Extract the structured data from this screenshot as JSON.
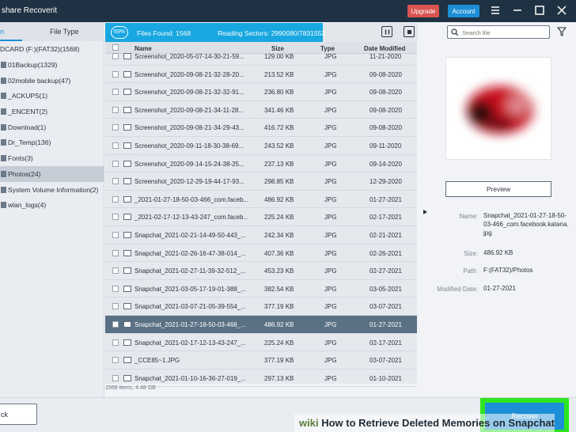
{
  "titlebar": {
    "app_title": "share Recoverit",
    "upgrade_label": "Upgrade",
    "account_label": "Account"
  },
  "sidebar": {
    "tab_active_label": "n",
    "tab_filetype_label": "File Type",
    "drive_label": "DCARD (F:)(FAT32)(1568)",
    "folders": [
      {
        "label": "01Backup(1329)",
        "selected": false
      },
      {
        "label": "02mobile backup(47)",
        "selected": false
      },
      {
        "label": "_ACKUPS(1)",
        "selected": false
      },
      {
        "label": "_ENCENT(2)",
        "selected": false
      },
      {
        "label": "Download(1)",
        "selected": false
      },
      {
        "label": "Dr_Temp(136)",
        "selected": false
      },
      {
        "label": "Fonts(3)",
        "selected": false
      },
      {
        "label": "Photos(24)",
        "selected": true
      },
      {
        "label": "System Volume Information(2)",
        "selected": false
      },
      {
        "label": "wlan_logs(4)",
        "selected": false
      }
    ]
  },
  "scan": {
    "percent": "69%",
    "files_found": "Files Found:  1568",
    "reading_sectors": "Reading Sectors:  2990080/7831552"
  },
  "table": {
    "headers": {
      "name": "Name",
      "size": "Size",
      "type": "Type",
      "date": "Date Modified"
    },
    "rows": [
      {
        "name": "Screenshot_2020-05-07-14-30-21-59...",
        "size": "129.00 KB",
        "type": "JPG",
        "date": "11-21-2020",
        "selected": false
      },
      {
        "name": "Screenshot_2020-09-08-21-32-28-20...",
        "size": "213.52 KB",
        "type": "JPG",
        "date": "09-08-2020",
        "selected": false
      },
      {
        "name": "Screenshot_2020-09-08-21-32-32-91...",
        "size": "236.80 KB",
        "type": "JPG",
        "date": "09-08-2020",
        "selected": false
      },
      {
        "name": "Screenshot_2020-09-08-21-34-11-28...",
        "size": "341.46 KB",
        "type": "JPG",
        "date": "09-08-2020",
        "selected": false
      },
      {
        "name": "Screenshot_2020-09-08-21-34-29-43...",
        "size": "416.72 KB",
        "type": "JPG",
        "date": "09-08-2020",
        "selected": false
      },
      {
        "name": "Screenshot_2020-09-11-18-30-38-69...",
        "size": "243.52 KB",
        "type": "JPG",
        "date": "09-11-2020",
        "selected": false
      },
      {
        "name": "Screenshot_2020-09-14-15-24-38-25...",
        "size": "237.13 KB",
        "type": "JPG",
        "date": "09-14-2020",
        "selected": false
      },
      {
        "name": "Screenshot_2020-12-29-19-44-17-93...",
        "size": "298.85 KB",
        "type": "JPG",
        "date": "12-29-2020",
        "selected": false
      },
      {
        "name": "_2021-01-27-18-50-03-466_com.faceb...",
        "size": "486.92 KB",
        "type": "JPG",
        "date": "01-27-2021",
        "selected": false
      },
      {
        "name": "_2021-02-17-12-13-43-247_com.faceb...",
        "size": "225.24 KB",
        "type": "JPG",
        "date": "02-17-2021",
        "selected": false
      },
      {
        "name": "Snapchat_2021-02-21-14-49-50-443_...",
        "size": "242.34 KB",
        "type": "JPG",
        "date": "02-21-2021",
        "selected": false
      },
      {
        "name": "Snapchat_2021-02-26-16-47-38-014_...",
        "size": "407.36 KB",
        "type": "JPG",
        "date": "02-26-2021",
        "selected": false
      },
      {
        "name": "Snapchat_2021-02-27-11-39-32-512_...",
        "size": "453.23 KB",
        "type": "JPG",
        "date": "02-27-2021",
        "selected": false
      },
      {
        "name": "Snapchat_2021-03-05-17-19-01-388_...",
        "size": "382.54 KB",
        "type": "JPG",
        "date": "03-05-2021",
        "selected": false
      },
      {
        "name": "Snapchat_2021-03-07-21-05-39-554_...",
        "size": "377.19 KB",
        "type": "JPG",
        "date": "03-07-2021",
        "selected": false
      },
      {
        "name": "Snapchat_2021-01-27-18-50-03-466_...",
        "size": "486.92 KB",
        "type": "JPG",
        "date": "01-27-2021",
        "selected": true
      },
      {
        "name": "Snapchat_2021-02-17-12-13-43-247_...",
        "size": "225.24 KB",
        "type": "JPG",
        "date": "02-17-2021",
        "selected": false
      },
      {
        "name": "_CCE85~1.JPG",
        "size": "377.19 KB",
        "type": "JPG",
        "date": "03-07-2021",
        "selected": false
      },
      {
        "name": "Snapchat_2021-01-10-16-36-27-019_...",
        "size": "297.13 KB",
        "type": "JPG",
        "date": "01-10-2021",
        "selected": false
      }
    ],
    "footer": "1568 items, 4.48 GB"
  },
  "preview": {
    "search_placeholder": "Search file",
    "button_label": "Preview",
    "name_label": "Name:",
    "name_value": "Snapchat_2021-01-27-18-50-03-466_com.facebook.katana.jpg",
    "size_label": "Size:",
    "size_value": "486.92 KB",
    "path_label": "Path:",
    "path_value": "F:(FAT32)/Photos",
    "modified_label": "Modified Date:",
    "modified_value": "01-27-2021"
  },
  "bottom": {
    "back_label": "ck",
    "recover_label": "Recover"
  },
  "watermark": {
    "wiki": "wiki",
    "text": "How to Retrieve Deleted Memories on Snapchat"
  },
  "colors": {
    "titlebar": "#1f3243",
    "accent": "#18a7e0",
    "upgrade": "#d9534f",
    "account": "#1d8fd6",
    "selected_row": "#5a7184",
    "recover_highlight": "#2ee51f"
  }
}
